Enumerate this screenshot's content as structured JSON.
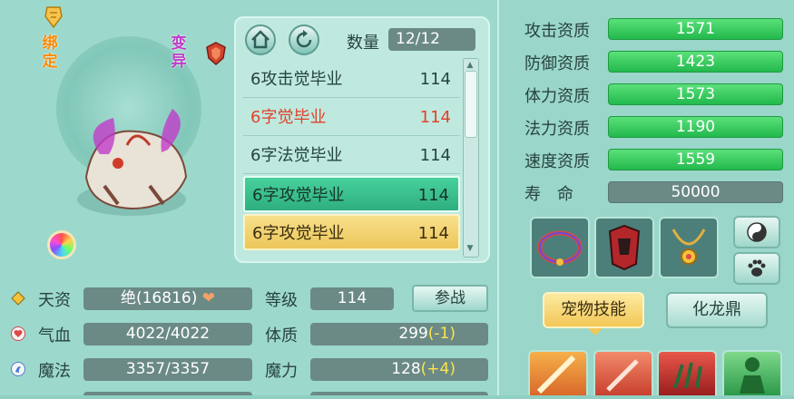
{
  "pet": {
    "tag_bound": "绑定",
    "tag_mutant": "变异"
  },
  "list_header": {
    "qty_label": "数量",
    "qty_value": "12/12"
  },
  "pet_list": [
    {
      "name": "6攻击觉毕业",
      "level": "114",
      "style": "normal"
    },
    {
      "name": "6字觉毕业",
      "level": "114",
      "style": "red"
    },
    {
      "name": "6字法觉毕业",
      "level": "114",
      "style": "normal"
    },
    {
      "name": "6字攻觉毕业",
      "level": "114",
      "style": "selected-green"
    },
    {
      "name": "6字攻觉毕业",
      "level": "114",
      "style": "selected-yellow"
    }
  ],
  "stats": {
    "aptitude_label": "天资",
    "aptitude_value": "绝(16816)",
    "level_label": "等级",
    "level_value": "114",
    "battle_button": "参战",
    "hp_label": "气血",
    "hp_value": "4022/4022",
    "con_label": "体质",
    "con_value": "299",
    "con_bonus": "(-1)",
    "mp_label": "魔法",
    "mp_value": "3357/3357",
    "mag_label": "魔力",
    "mag_value": "128",
    "mag_bonus": "(+4)"
  },
  "attributes": [
    {
      "label": "攻击资质",
      "value": "1571"
    },
    {
      "label": "防御资质",
      "value": "1423"
    },
    {
      "label": "体力资质",
      "value": "1573"
    },
    {
      "label": "法力资质",
      "value": "1190"
    },
    {
      "label": "速度资质",
      "value": "1559"
    },
    {
      "label": "寿　命",
      "value": "50000"
    }
  ],
  "tabs": {
    "skill": "宠物技能",
    "dragon": "化龙鼎"
  },
  "colors": {
    "attr_bar": "#2fc25a",
    "selected_row": "#3cc48e",
    "highlight_row": "#f3d36f",
    "stat_box": "#6b8a85"
  },
  "icons": [
    "favorite-icon",
    "shield-icon",
    "home-icon",
    "refresh-icon",
    "color-wheel-icon",
    "diamond-icon",
    "heart-icon",
    "magic-icon",
    "yin-yang-icon",
    "paw-icon"
  ]
}
